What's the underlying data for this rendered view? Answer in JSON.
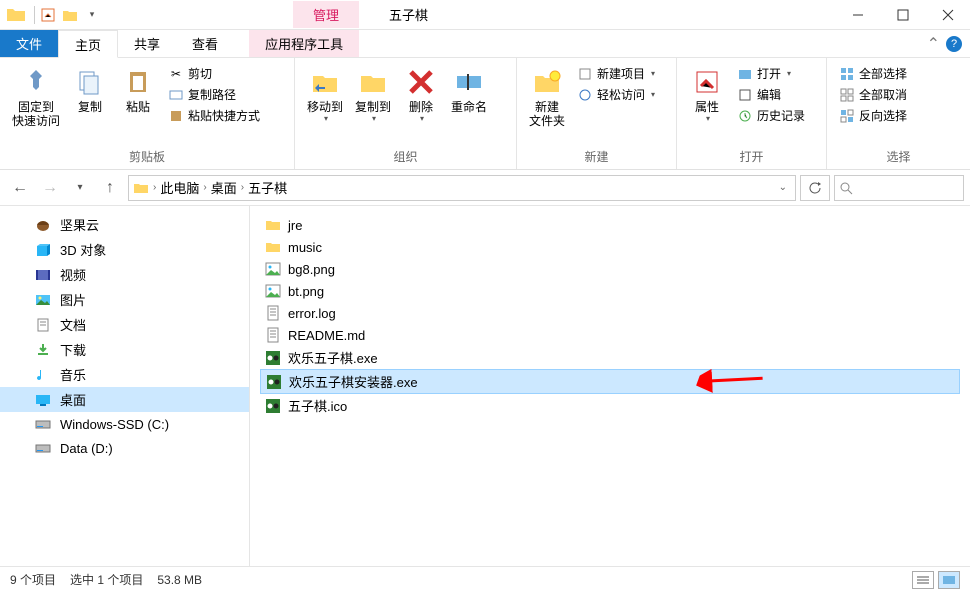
{
  "titlebar": {
    "context_tab": "管理",
    "window_title": "五子棋"
  },
  "tabs": {
    "file": "文件",
    "home": "主页",
    "share": "共享",
    "view": "查看",
    "tools": "应用程序工具"
  },
  "ribbon": {
    "clipboard": {
      "pin": "固定到\n快速访问",
      "copy": "复制",
      "paste": "粘贴",
      "cut": "剪切",
      "copy_path": "复制路径",
      "paste_shortcut": "粘贴快捷方式",
      "group": "剪贴板"
    },
    "organize": {
      "move_to": "移动到",
      "copy_to": "复制到",
      "delete": "删除",
      "rename": "重命名",
      "group": "组织"
    },
    "new": {
      "new_folder": "新建\n文件夹",
      "new_item": "新建项目",
      "easy_access": "轻松访问",
      "group": "新建"
    },
    "open": {
      "properties": "属性",
      "open": "打开",
      "edit": "编辑",
      "history": "历史记录",
      "group": "打开"
    },
    "select": {
      "select_all": "全部选择",
      "select_none": "全部取消",
      "invert": "反向选择",
      "group": "选择"
    }
  },
  "breadcrumb": {
    "pc": "此电脑",
    "desktop": "桌面",
    "folder": "五子棋"
  },
  "sidebar": {
    "items": [
      {
        "label": "坚果云",
        "icon": "nut"
      },
      {
        "label": "3D 对象",
        "icon": "3d"
      },
      {
        "label": "视频",
        "icon": "video"
      },
      {
        "label": "图片",
        "icon": "pictures"
      },
      {
        "label": "文档",
        "icon": "documents"
      },
      {
        "label": "下载",
        "icon": "downloads"
      },
      {
        "label": "音乐",
        "icon": "music"
      },
      {
        "label": "桌面",
        "icon": "desktop",
        "selected": true
      },
      {
        "label": "Windows-SSD (C:)",
        "icon": "drive"
      },
      {
        "label": "Data (D:)",
        "icon": "drive"
      }
    ]
  },
  "files": [
    {
      "name": "jre",
      "type": "folder"
    },
    {
      "name": "music",
      "type": "folder"
    },
    {
      "name": "bg8.png",
      "type": "image"
    },
    {
      "name": "bt.png",
      "type": "image"
    },
    {
      "name": "error.log",
      "type": "text"
    },
    {
      "name": "README.md",
      "type": "text"
    },
    {
      "name": "欢乐五子棋.exe",
      "type": "exe"
    },
    {
      "name": "欢乐五子棋安装器.exe",
      "type": "exe",
      "selected": true
    },
    {
      "name": "五子棋.ico",
      "type": "exe"
    }
  ],
  "status": {
    "count": "9 个项目",
    "selection": "选中 1 个项目",
    "size": "53.8 MB"
  }
}
